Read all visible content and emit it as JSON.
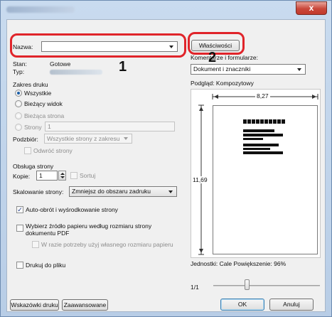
{
  "window": {
    "close_label": "x"
  },
  "printer": {
    "name_label": "Nazwa:",
    "status_label": "Stan:",
    "status_value": "Gotowe",
    "type_label": "Typ:",
    "properties_button": "Właściwości",
    "comments_label": "Komentarze i formularze:",
    "comments_value": "Dokument i znaczniki"
  },
  "annotations": {
    "marker1": "1",
    "marker2": "2"
  },
  "print_range": {
    "title": "Zakres druku",
    "all": "Wszystkie",
    "current_view": "Bieżący widok",
    "current_page": "Bieżąca strona",
    "pages": "Strony",
    "pages_value": "1",
    "subset_label": "Podzbiór:",
    "subset_value": "Wszystkie strony z zakresu",
    "reverse": "Odwróć strony"
  },
  "page_handling": {
    "title": "Obsługa strony",
    "copies_label": "Kopie:",
    "copies_value": "1",
    "collate": "Sortuj",
    "scaling_label": "Skalowanie strony:",
    "scaling_value": "Zmniejsz do obszaru zadruku",
    "auto_rotate": "Auto-obrót i wyśrodkowanie strony",
    "choose_source": "Wybierz źródło papieru według rozmiaru strony dokumentu PDF",
    "custom_size": "W razie potrzeby użyj własnego rozmiaru papieru"
  },
  "print_to_file": "Drukuj do pliku",
  "preview": {
    "label": "Podgląd: Kompozytowy",
    "width": "8,27",
    "height": "11,69",
    "units_line": "Jednostki: Cale Powiększenie:  96%",
    "page_indicator": "1/1"
  },
  "buttons": {
    "hints": "Wskazówki druku",
    "advanced": "Zaawansowane",
    "ok": "OK",
    "cancel": "Anuluj"
  }
}
